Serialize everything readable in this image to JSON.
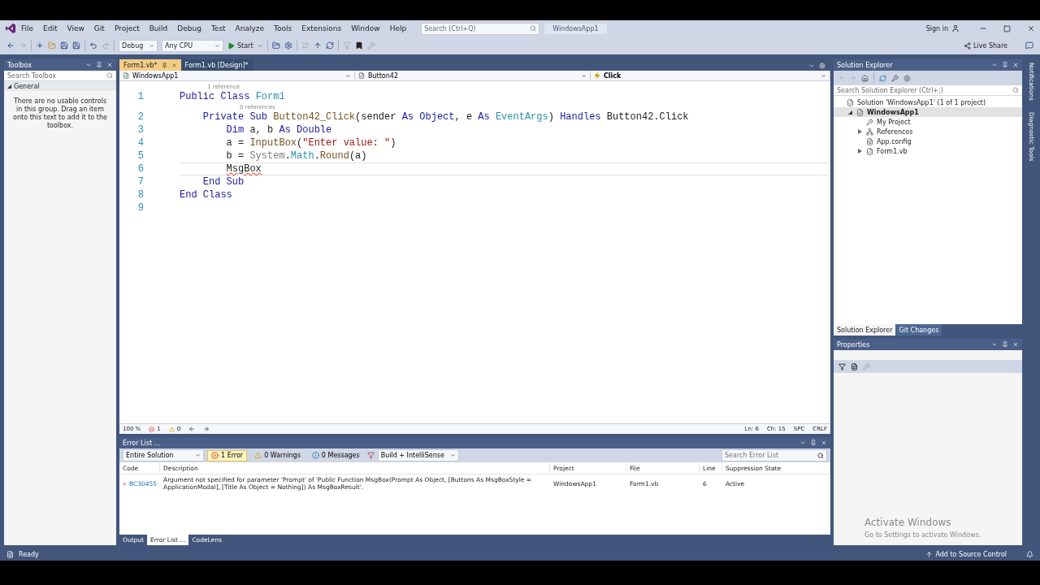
{
  "menu": {
    "items": [
      "File",
      "Edit",
      "View",
      "Git",
      "Project",
      "Build",
      "Debug",
      "Test",
      "Analyze",
      "Tools",
      "Extensions",
      "Window",
      "Help"
    ],
    "search_placeholder": "Search (Ctrl+Q)",
    "solution_name": "WindowsApp1",
    "sign_in": "Sign in"
  },
  "toolbar": {
    "configuration": "Debug",
    "platform": "Any CPU",
    "start": "Start",
    "live_share": "Live Share"
  },
  "toolbox": {
    "title": "Toolbox",
    "search_placeholder": "Search Toolbox",
    "group": "General",
    "group_expanded": true,
    "empty_text": "There are no usable controls in this group. Drag an item onto this text to add it to the toolbox."
  },
  "editor": {
    "tabs": [
      {
        "label": "Form1.vb*",
        "selected": true
      },
      {
        "label": "Form1.vb [Design]*",
        "selected": false
      }
    ],
    "nav": [
      "WindowsApp1",
      "Button42",
      "Click"
    ],
    "lines": [
      {
        "number": "1",
        "codelens": "1 reference",
        "current": false,
        "tokens": [
          {
            "text": "Public Class ",
            "kind": "keyword"
          },
          {
            "text": "Form1",
            "kind": "type"
          }
        ]
      },
      {
        "number": "2",
        "codelens": "0 references",
        "current": false,
        "tokens": [
          {
            "text": "    Private Sub ",
            "kind": "keyword"
          },
          {
            "text": "Button42_Click",
            "kind": "method"
          },
          {
            "text": "(sender ",
            "kind": "plain"
          },
          {
            "text": "As Object",
            "kind": "keyword"
          },
          {
            "text": ", e ",
            "kind": "plain"
          },
          {
            "text": "As ",
            "kind": "keyword"
          },
          {
            "text": "EventArgs",
            "kind": "type"
          },
          {
            "text": ") ",
            "kind": "plain"
          },
          {
            "text": "Handles ",
            "kind": "keyword"
          },
          {
            "text": "Button42.Click",
            "kind": "plain"
          }
        ]
      },
      {
        "number": "3",
        "current": false,
        "tokens": [
          {
            "text": "        Dim ",
            "kind": "keyword"
          },
          {
            "text": "a, b ",
            "kind": "plain"
          },
          {
            "text": "As Double",
            "kind": "keyword"
          }
        ]
      },
      {
        "number": "4",
        "current": false,
        "tokens": [
          {
            "text": "        a = ",
            "kind": "plain"
          },
          {
            "text": "InputBox",
            "kind": "method"
          },
          {
            "text": "(",
            "kind": "plain"
          },
          {
            "text": "\"Enter value: \"",
            "kind": "string"
          },
          {
            "text": ")",
            "kind": "plain"
          }
        ]
      },
      {
        "number": "5",
        "current": false,
        "tokens": [
          {
            "text": "        b = ",
            "kind": "plain"
          },
          {
            "text": "System",
            "kind": "namespace"
          },
          {
            "text": ".",
            "kind": "plain"
          },
          {
            "text": "Math",
            "kind": "type"
          },
          {
            "text": ".",
            "kind": "plain"
          },
          {
            "text": "Round",
            "kind": "method"
          },
          {
            "text": "(a)",
            "kind": "plain"
          }
        ]
      },
      {
        "number": "6",
        "current": true,
        "tokens": [
          {
            "text": "        MsgBox",
            "kind": "error"
          }
        ]
      },
      {
        "number": "7",
        "current": false,
        "tokens": [
          {
            "text": "    End Sub",
            "kind": "keyword"
          }
        ]
      },
      {
        "number": "8",
        "current": false,
        "tokens": [
          {
            "text": "End Class",
            "kind": "keyword"
          }
        ]
      },
      {
        "number": "9",
        "current": false
      }
    ],
    "status": {
      "zoom": "100 %",
      "errors": "1",
      "warnings": "0",
      "line": "Ln: 6",
      "column": "Ch: 15",
      "spacing": "SPC",
      "line_ending": "CRLF"
    }
  },
  "error_list": {
    "title": "Error List ...",
    "scope": "Entire Solution",
    "filters": [
      {
        "kind": "error",
        "label": "1 Error",
        "selected": true
      },
      {
        "kind": "warning",
        "label": "0 Warnings",
        "selected": false
      },
      {
        "kind": "message",
        "label": "0 Messages",
        "selected": false
      }
    ],
    "source": "Build + IntelliSense",
    "search_placeholder": "Search Error List",
    "columns": [
      "Code",
      "Description",
      "Project",
      "File",
      "Line",
      "Suppression State"
    ],
    "rows": [
      {
        "code": "BC30455",
        "description": "Argument not specified for parameter 'Prompt' of 'Public Function MsgBox(Prompt As Object, [Buttons As MsgBoxStyle = ApplicationModal], [Title As Object = Nothing]) As MsgBoxResult'.",
        "project": "WindowsApp1",
        "file": "Form1.vb",
        "line": "6",
        "suppression": "Active"
      }
    ]
  },
  "bottom_tabs": [
    {
      "label": "Output",
      "selected": false
    },
    {
      "label": "Error List ...",
      "selected": true
    },
    {
      "label": "CodeLens",
      "selected": false
    }
  ],
  "solution_explorer": {
    "title": "Solution Explorer",
    "search_placeholder": "Search Solution Explorer (Ctrl+;)",
    "tree": [
      {
        "label": "Solution 'WindowsApp1' (1 of 1 project)",
        "children": [
          {
            "label": "WindowsApp1",
            "expanded": true,
            "selected": true,
            "children": [
              {
                "label": "My Project"
              },
              {
                "label": "References",
                "expanded": false
              },
              {
                "label": "App.config"
              },
              {
                "label": "Form1.vb",
                "expanded": false
              }
            ]
          }
        ]
      }
    ],
    "tabs": [
      {
        "label": "Solution Explorer",
        "selected": true
      },
      {
        "label": "Git Changes",
        "selected": false
      }
    ]
  },
  "properties": {
    "title": "Properties"
  },
  "side_tabs": [
    "Notifications",
    "Diagnostic Tools"
  ],
  "activation": {
    "title": "Activate Windows",
    "subtitle": "Go to Settings to activate Windows."
  },
  "status_bar": {
    "text": "Ready",
    "source_control": "Add to Source Control"
  }
}
